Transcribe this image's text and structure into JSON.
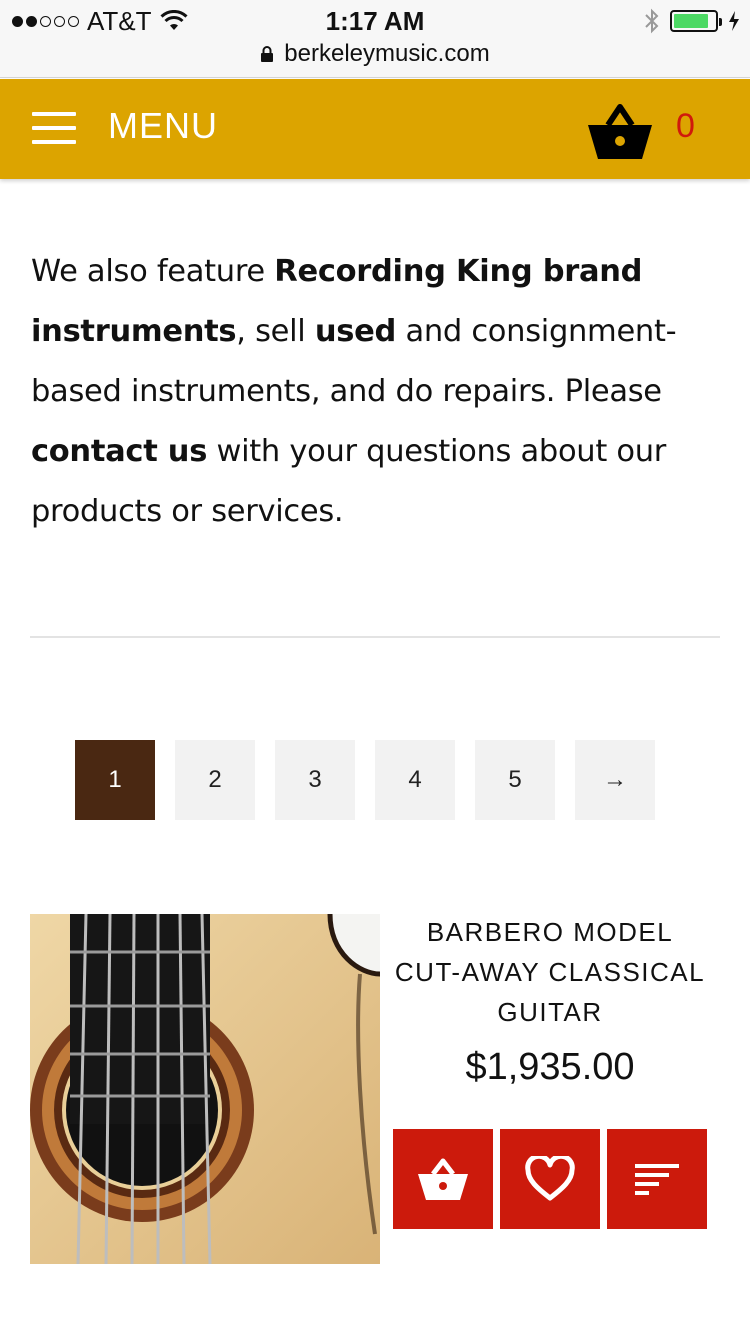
{
  "status_bar": {
    "carrier": "AT&T",
    "time": "1:17 AM",
    "url": "berkeleymusic.com",
    "signal_bars_on": 2,
    "signal_bars_total": 5,
    "battery_level": 0.85
  },
  "header": {
    "menu_label": "MENU",
    "cart_count": "0",
    "background_color": "#dca400",
    "cart_count_color": "#d0190c"
  },
  "intro": {
    "t1": "We also feature ",
    "b1": "Recording King brand instruments",
    "t2": ", sell ",
    "b2": "used",
    "t3": " and consignment-based instruments, and do repairs. Please ",
    "b3": "contact us",
    "t4": " with your questions about our products or services."
  },
  "pagination": {
    "pages": [
      "1",
      "2",
      "3",
      "4",
      "5"
    ],
    "next": "→",
    "active_page": "1",
    "active_color": "#4a2812"
  },
  "product": {
    "title": "BARBERO MODEL CUT-AWAY CLASSICAL GUITAR",
    "price": "$1,935.00",
    "button_color": "#cc1a0c",
    "actions": [
      "basket-icon",
      "heart-icon",
      "sort-lines-icon"
    ]
  }
}
